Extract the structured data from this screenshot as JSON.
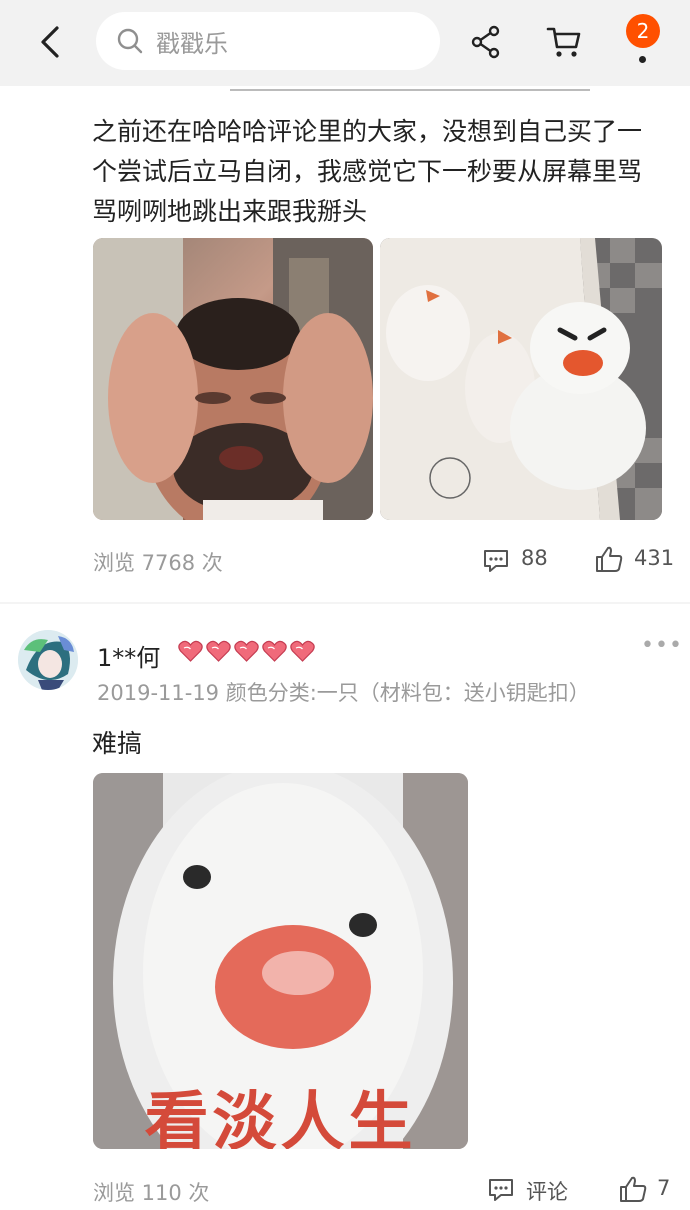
{
  "topbar": {
    "search_placeholder": "戳戳乐",
    "badge_count": "2"
  },
  "post1": {
    "text": "之前还在哈哈哈评论里的大家，没想到自己买了一个尝试后立马自闭，我感觉它下一秒要从屏幕里骂骂咧咧地跳出来跟我掰头",
    "views_label": "浏览 7768 次",
    "comments": "88",
    "likes": "431"
  },
  "post2": {
    "username": "1**何",
    "meta": "2019-11-19 颜色分类:一只（材料包：送小钥匙扣）",
    "text": "难搞",
    "image_caption": "看淡人生",
    "views_label": "浏览 110 次",
    "comment_label": "评论",
    "likes": "7"
  },
  "colors": {
    "accent": "#ff5000",
    "muted": "#9a9a9a"
  }
}
